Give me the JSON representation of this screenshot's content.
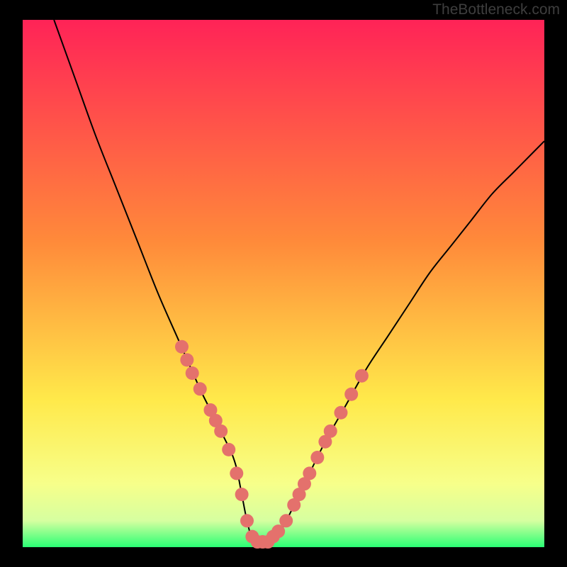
{
  "watermark": "TheBottleneck.com",
  "chart_data": {
    "type": "line",
    "title": "",
    "xlabel": "",
    "ylabel": "",
    "xlim": [
      0,
      100
    ],
    "ylim": [
      0,
      100
    ],
    "series": [
      {
        "name": "curve",
        "x": [
          6,
          10,
          14,
          18,
          22,
          26,
          30,
          34,
          36,
          38,
          39,
          40,
          41,
          42,
          43,
          44,
          45,
          46,
          48,
          50,
          54,
          58,
          62,
          66,
          70,
          74,
          78,
          82,
          86,
          90,
          94,
          98,
          100
        ],
        "y": [
          100,
          89,
          78,
          68,
          58,
          48,
          39,
          30,
          26,
          22,
          20,
          18,
          15,
          10,
          5,
          1.5,
          1,
          1,
          1.5,
          4,
          12,
          20,
          27,
          34,
          40,
          46,
          52,
          57,
          62,
          67,
          71,
          75,
          77
        ]
      }
    ],
    "markers": [
      {
        "x": 30.5,
        "y": 38
      },
      {
        "x": 31.5,
        "y": 35.5
      },
      {
        "x": 32.5,
        "y": 33
      },
      {
        "x": 34,
        "y": 30
      },
      {
        "x": 36,
        "y": 26
      },
      {
        "x": 37,
        "y": 24
      },
      {
        "x": 38,
        "y": 22
      },
      {
        "x": 39.5,
        "y": 18.5
      },
      {
        "x": 41,
        "y": 14
      },
      {
        "x": 42,
        "y": 10
      },
      {
        "x": 43,
        "y": 5
      },
      {
        "x": 44,
        "y": 2
      },
      {
        "x": 45,
        "y": 1
      },
      {
        "x": 46,
        "y": 1
      },
      {
        "x": 47,
        "y": 1
      },
      {
        "x": 48,
        "y": 2
      },
      {
        "x": 49,
        "y": 3
      },
      {
        "x": 50.5,
        "y": 5
      },
      {
        "x": 52,
        "y": 8
      },
      {
        "x": 53,
        "y": 10
      },
      {
        "x": 54,
        "y": 12
      },
      {
        "x": 55,
        "y": 14
      },
      {
        "x": 56.5,
        "y": 17
      },
      {
        "x": 58,
        "y": 20
      },
      {
        "x": 59,
        "y": 22
      },
      {
        "x": 61,
        "y": 25.5
      },
      {
        "x": 63,
        "y": 29
      },
      {
        "x": 65,
        "y": 32.5
      }
    ],
    "colors": {
      "gradient_top": "#ff2357",
      "gradient_mid1": "#ff8a3a",
      "gradient_mid2": "#ffe94a",
      "gradient_band": "#f7ff8a",
      "gradient_bottom": "#2aff74",
      "marker": "#e4716c",
      "curve": "#000000",
      "frame": "#000000"
    },
    "frame": {
      "outer_width": 800,
      "outer_height": 800,
      "inner_left": 32,
      "inner_top": 28,
      "inner_width": 736,
      "inner_height": 744
    }
  }
}
